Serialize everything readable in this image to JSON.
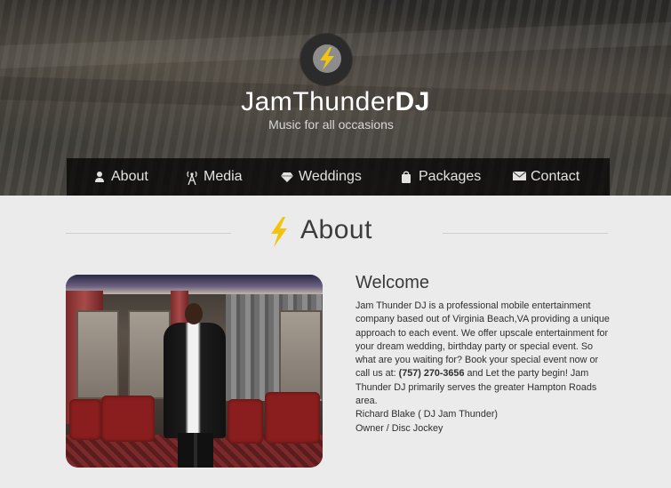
{
  "header": {
    "title_part1": "JamThunder",
    "title_part2": "DJ",
    "tagline": "Music for all occasions",
    "logo_icon": "lightning-bolt-icon"
  },
  "nav": {
    "items": [
      {
        "label": "About",
        "icon": "person-icon"
      },
      {
        "label": "Media",
        "icon": "antenna-icon"
      },
      {
        "label": "Weddings",
        "icon": "diamond-icon"
      },
      {
        "label": "Packages",
        "icon": "bag-icon"
      },
      {
        "label": "Contact",
        "icon": "envelope-icon"
      }
    ]
  },
  "about": {
    "heading": "About",
    "heading_icon": "lightning-bolt-icon",
    "welcome": "Welcome",
    "paragraph_before_phone": "Jam Thunder DJ is a professional mobile entertainment company based out of Virginia Beach,VA providing a unique approach to each event. We offer upscale entertainment for your dream wedding, birthday party or special event. So what are you waiting for? Book your special event now or call us at:",
    "phone": "(757) 270-3656",
    "paragraph_after_phone": "and Let the party begin! Jam Thunder DJ primarily serves the greater Hampton Roads area.",
    "signature_name": "Richard Blake ( DJ Jam Thunder)",
    "signature_role": "Owner / Disc Jockey"
  },
  "colors": {
    "accent_bolt": "#f2c40f",
    "nav_background": "#000000",
    "page_background": "#ebebeb"
  }
}
